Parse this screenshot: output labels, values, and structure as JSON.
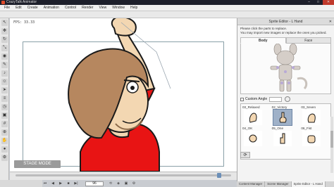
{
  "window": {
    "title": "CrazyTalk Animator"
  },
  "menu": [
    "File",
    "Edit",
    "Create",
    "Animation",
    "Control",
    "Render",
    "View",
    "Window",
    "Help"
  ],
  "stage": {
    "fps": "FPS: 33.33",
    "mode_button": "STAGE MODE"
  },
  "playback": {
    "current_frame": "96"
  },
  "sprite_editor": {
    "title": "Sprite Editor - L Hand",
    "instructions": [
      "Please click the parts to replace.",
      "You may import new images or replace the ones you picked."
    ],
    "tabs": [
      "Body",
      "Face"
    ],
    "active_tab": "Body",
    "custom_angle_label": "Custom Angle",
    "parts_row1": [
      "03_Relaxed",
      "02_Victory",
      "03_Seven"
    ],
    "parts_row2": [
      "04_OK",
      "05_One",
      "06_Fist"
    ],
    "selected_part": "05_One"
  },
  "bottom_tabs": [
    "Content Manager",
    "Scene Manager",
    "Sprite Editor - L Hand"
  ],
  "active_bottom_tab": "Sprite Editor - L Hand",
  "colors": {
    "shirt": "#e81414",
    "hair": "#b6875f",
    "skin": "#f3d7b2",
    "selection": "#9fb1c8"
  }
}
